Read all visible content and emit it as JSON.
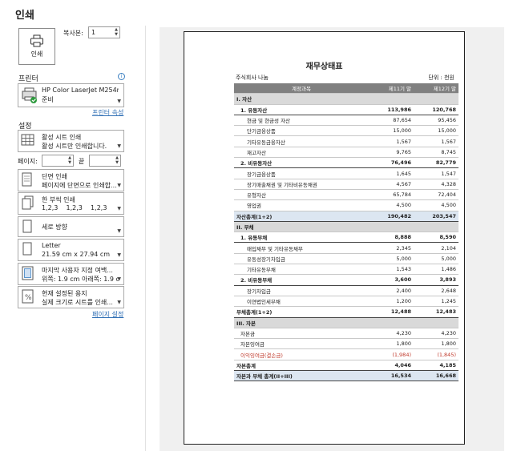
{
  "header": {
    "title": "인쇄"
  },
  "print_button": {
    "label": "인쇄"
  },
  "copies": {
    "label": "복사본:",
    "value": "1"
  },
  "printer": {
    "section_label": "프린터",
    "info": "i",
    "name": "HP Color LaserJet M254n...",
    "status": "준비",
    "properties_link": "프린터 속성"
  },
  "settings": {
    "section_label": "설정",
    "what_to_print": {
      "line1": "활성 시트 인쇄",
      "line2": "활성 시트만 인쇄합니다."
    },
    "pages_label": "페이지:",
    "to_label": "끝",
    "sides": {
      "line1": "단면 인쇄",
      "line2": "페이지에 단면으로 인쇄합..."
    },
    "collate": {
      "line1": "한 부씩 인쇄",
      "line2": "1,2,3    1,2,3    1,2,3"
    },
    "orientation": {
      "line1": "세로 방향"
    },
    "paper": {
      "line1": "Letter",
      "line2": "21.59 cm x 27.94 cm"
    },
    "margins": {
      "line1": "마지막 사용자 지정 여백...",
      "line2": "위쪽: 1.9 cm 아래쪽: 1.9 c..."
    },
    "scaling": {
      "line1": "현재 설정된 용지",
      "line2": "실제 크기로 시트를 인쇄..."
    },
    "page_setup_link": "페이지 설정"
  },
  "preview": {
    "title": "재무상태표",
    "company": "주식회사 나눔",
    "unit": "단위 : 천원",
    "columns": [
      "계정과목",
      "제11기 말",
      "제12기 말"
    ],
    "rows": [
      {
        "type": "section",
        "label": "I. 자산",
        "a": "",
        "b": ""
      },
      {
        "type": "sub",
        "label": "1. 유동자산",
        "a": "113,986",
        "b": "120,768"
      },
      {
        "type": "item",
        "label": "현금 및 현금성 자산",
        "a": "87,654",
        "b": "95,456"
      },
      {
        "type": "item",
        "label": "단기금융상품",
        "a": "15,000",
        "b": "15,000"
      },
      {
        "type": "item",
        "label": "기타유동금융자산",
        "a": "1,567",
        "b": "1,567"
      },
      {
        "type": "item",
        "label": "재고자산",
        "a": "9,765",
        "b": "8,745"
      },
      {
        "type": "sub",
        "label": "2. 비유동자산",
        "a": "76,496",
        "b": "82,779"
      },
      {
        "type": "item",
        "label": "장기금융상품",
        "a": "1,645",
        "b": "1,547"
      },
      {
        "type": "item",
        "label": "장기매출채권 및 기타비유동채권",
        "a": "4,567",
        "b": "4,328"
      },
      {
        "type": "item",
        "label": "유형자산",
        "a": "65,784",
        "b": "72,404"
      },
      {
        "type": "item",
        "label": "영업권",
        "a": "4,500",
        "b": "4,500"
      },
      {
        "type": "total",
        "label": "자산총계(1+2)",
        "a": "190,482",
        "b": "203,547"
      },
      {
        "type": "section",
        "label": "II. 부채",
        "a": "",
        "b": ""
      },
      {
        "type": "sub",
        "label": "1. 유동부채",
        "a": "8,888",
        "b": "8,590"
      },
      {
        "type": "item",
        "label": "매입채무 및 기타유동채무",
        "a": "2,345",
        "b": "2,104"
      },
      {
        "type": "item",
        "label": "유동성장기차입금",
        "a": "5,000",
        "b": "5,000"
      },
      {
        "type": "item",
        "label": "기타유동부채",
        "a": "1,543",
        "b": "1,486"
      },
      {
        "type": "sub",
        "label": "2. 비유동부채",
        "a": "3,600",
        "b": "3,893"
      },
      {
        "type": "item",
        "label": "장기차입금",
        "a": "2,400",
        "b": "2,648"
      },
      {
        "type": "item",
        "label": "이연법인세부채",
        "a": "1,200",
        "b": "1,245"
      },
      {
        "type": "subtotal",
        "label": "부채총계(1+2)",
        "a": "12,488",
        "b": "12,483"
      },
      {
        "type": "section",
        "label": "III. 자본",
        "a": "",
        "b": ""
      },
      {
        "type": "plain",
        "label": "자본금",
        "a": "4,230",
        "b": "4,230"
      },
      {
        "type": "plain",
        "label": "자본잉여금",
        "a": "1,800",
        "b": "1,800"
      },
      {
        "type": "neg",
        "label": "이익잉여금(결손금)",
        "a": "(1,984)",
        "b": "(1,845)"
      },
      {
        "type": "subtotal",
        "label": "자본총계",
        "a": "4,046",
        "b": "4,185"
      },
      {
        "type": "total",
        "label": "자본과 부채 총계(II+III)",
        "a": "16,534",
        "b": "16,668"
      }
    ]
  }
}
